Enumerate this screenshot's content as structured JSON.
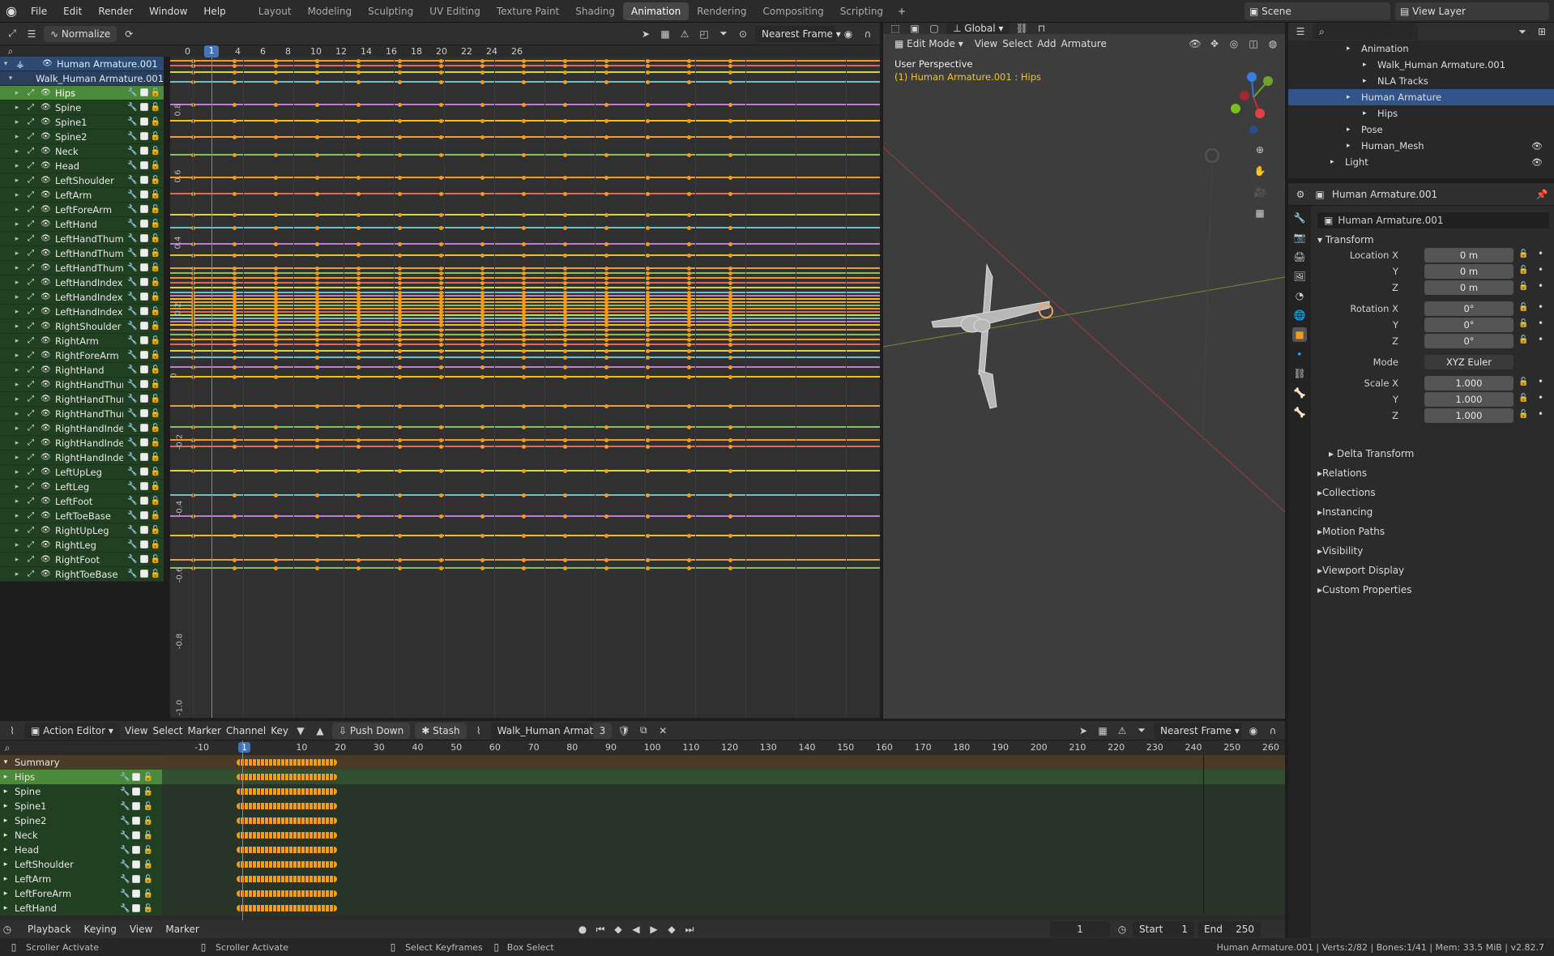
{
  "menu": [
    "File",
    "Edit",
    "Render",
    "Window",
    "Help"
  ],
  "workspaces": [
    "Layout",
    "Modeling",
    "Sculpting",
    "UV Editing",
    "Texture Paint",
    "Shading",
    "Animation",
    "Rendering",
    "Compositing",
    "Scripting"
  ],
  "active_workspace": "Animation",
  "scene": "Scene",
  "view_layer": "View Layer",
  "graph": {
    "normalize": "Normalize",
    "snap": "Nearest Frame",
    "current_frame": "1",
    "ruler": [
      "0",
      "2",
      "4",
      "6",
      "8",
      "10",
      "12",
      "14",
      "16",
      "18",
      "20",
      "22",
      "24",
      "26"
    ],
    "yticks": [
      "0.8",
      "0.6",
      "0.4",
      "0.2",
      "0",
      "-0.2",
      "-0.4",
      "-0.6",
      "-0.8",
      "-1.0"
    ],
    "armature": "Human Armature.001",
    "action": "Walk_Human Armature.001",
    "channels": [
      "Hips",
      "Spine",
      "Spine1",
      "Spine2",
      "Neck",
      "Head",
      "LeftShoulder",
      "LeftArm",
      "LeftForeArm",
      "LeftHand",
      "LeftHandThumb",
      "LeftHandThumb",
      "LeftHandThumb",
      "LeftHandIndex1",
      "LeftHandIndex2",
      "LeftHandIndex3",
      "RightShoulder",
      "RightArm",
      "RightForeArm",
      "RightHand",
      "RightHandThum",
      "RightHandThum",
      "RightHandThum",
      "RightHandIndex",
      "RightHandIndex",
      "RightHandIndex",
      "LeftUpLeg",
      "LeftLeg",
      "LeftFoot",
      "LeftToeBase",
      "RightUpLeg",
      "RightLeg",
      "RightFoot",
      "RightToeBase"
    ]
  },
  "viewport": {
    "mode": "Edit Mode",
    "menus": [
      "View",
      "Select",
      "Add",
      "Armature"
    ],
    "orientation": "Global",
    "perspective": "User Perspective",
    "object_info": "(1) Human Armature.001 : Hips"
  },
  "outliner": {
    "rows": [
      {
        "label": "Animation",
        "indent": 90
      },
      {
        "label": "Walk_Human Armature.001",
        "indent": 110
      },
      {
        "label": "NLA Tracks",
        "indent": 110
      },
      {
        "label": "Human Armature",
        "indent": 90,
        "sel": true
      },
      {
        "label": "Hips",
        "indent": 110
      },
      {
        "label": "Pose",
        "indent": 90
      },
      {
        "label": "Human_Mesh",
        "indent": 90
      },
      {
        "label": "Light",
        "indent": 70
      }
    ]
  },
  "properties": {
    "object_name": "Human Armature.001",
    "object_field": "Human Armature.001",
    "transform": "Transform",
    "location_label": "Location X",
    "loc": [
      "0 m",
      "0 m",
      "0 m"
    ],
    "rotation_label": "Rotation X",
    "rot": [
      "0°",
      "0°",
      "0°"
    ],
    "mode_label": "Mode",
    "mode": "XYZ Euler",
    "scale_label": "Scale X",
    "scale": [
      "1.000",
      "1.000",
      "1.000"
    ],
    "y": "Y",
    "z": "Z",
    "delta": "Delta Transform",
    "sections": [
      "Relations",
      "Collections",
      "Instancing",
      "Motion Paths",
      "Visibility",
      "Viewport Display",
      "Custom Properties"
    ]
  },
  "action_editor": {
    "type": "Action Editor",
    "menus": [
      "View",
      "Select",
      "Marker",
      "Channel",
      "Key"
    ],
    "push_down": "Push Down",
    "stash": "Stash",
    "action": "Walk_Human Armat...",
    "users": "3",
    "snap": "Nearest Frame",
    "ruler": [
      "-10",
      "1",
      "10",
      "20",
      "30",
      "40",
      "50",
      "60",
      "70",
      "80",
      "90",
      "100",
      "110",
      "120",
      "130",
      "140",
      "150",
      "160",
      "170",
      "180",
      "190",
      "200",
      "210",
      "220",
      "230",
      "240",
      "250",
      "260"
    ],
    "summary": "Summary",
    "channels": [
      "Hips",
      "Spine",
      "Spine1",
      "Spine2",
      "Neck",
      "Head",
      "LeftShoulder",
      "LeftArm",
      "LeftForeArm",
      "LeftHand"
    ]
  },
  "timeline": {
    "menus": [
      "Playback",
      "Keying",
      "View",
      "Marker"
    ],
    "frame": "1",
    "start_label": "Start",
    "start": "1",
    "end_label": "End",
    "end": "250"
  },
  "status": {
    "left1": "Scroller Activate",
    "left2": "Scroller Activate",
    "mid1": "Select Keyframes",
    "mid2": "Box Select",
    "right": "Human Armature.001 | Verts:2/82 | Bones:1/41 | Mem: 33.5 MiB | v2.82.7"
  }
}
